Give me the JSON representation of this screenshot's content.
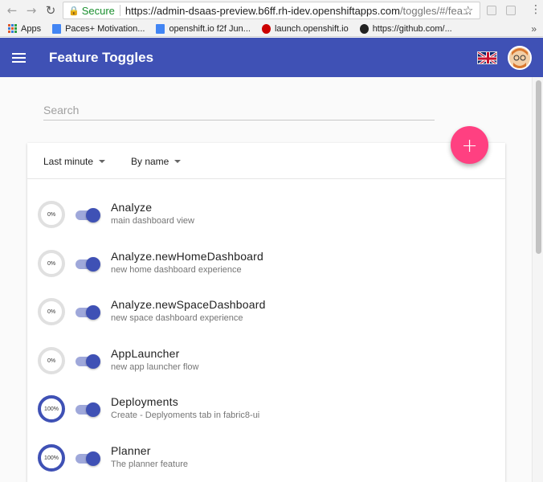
{
  "browser": {
    "secure_label": "Secure",
    "url_host": "https://admin-dsaas-preview.b6ff.rh-idev.openshiftapps.com",
    "url_rest": "/toggles/#/fea...",
    "bookmarks": [
      {
        "label": "Apps"
      },
      {
        "label": "Paces+ Motivation..."
      },
      {
        "label": "openshift.io f2f Jun..."
      },
      {
        "label": "launch.openshift.io"
      },
      {
        "label": "https://github.com/..."
      }
    ],
    "more_bookmarks": "»"
  },
  "appbar": {
    "title": "Feature Toggles"
  },
  "search": {
    "placeholder": "Search"
  },
  "filters": {
    "time_label": "Last minute",
    "sort_label": "By name"
  },
  "fab": {
    "label": "+"
  },
  "toggles": [
    {
      "name": "Analyze",
      "description": "main dashboard view",
      "percent": "0%",
      "enabled": true
    },
    {
      "name": "Analyze.newHomeDashboard",
      "description": "new home dashboard experience",
      "percent": "0%",
      "enabled": true
    },
    {
      "name": "Analyze.newSpaceDashboard",
      "description": "new space dashboard experience",
      "percent": "0%",
      "enabled": true
    },
    {
      "name": "AppLauncher",
      "description": "new app launcher flow",
      "percent": "0%",
      "enabled": true
    },
    {
      "name": "Deployments",
      "description": "Create - Deplyoments tab in fabric8-ui",
      "percent": "100%",
      "enabled": true
    },
    {
      "name": "Planner",
      "description": "The planner feature",
      "percent": "100%",
      "enabled": true
    }
  ],
  "colors": {
    "primary": "#3f51b5",
    "accent": "#ff4081"
  }
}
